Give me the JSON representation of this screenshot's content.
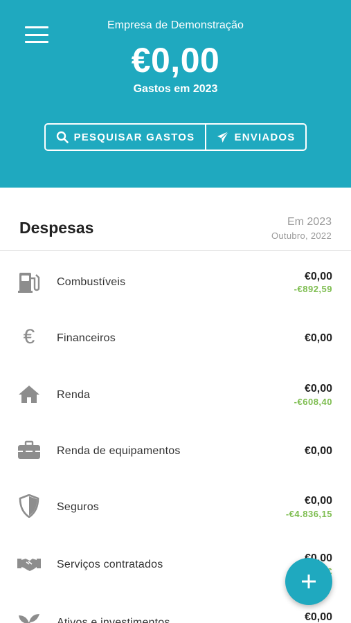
{
  "header": {
    "company": "Empresa de Demonstração",
    "total": "€0,00",
    "total_label": "Gastos em 2023",
    "search_button": "PESQUISAR GASTOS",
    "sent_button": "ENVIADOS"
  },
  "section": {
    "title": "Despesas",
    "period": "Em 2023",
    "compare": "Outubro, 2022"
  },
  "categories": [
    {
      "label": "Combustíveis",
      "icon": "fuel-pump-icon",
      "value": "€0,00",
      "diff": "-€892,59"
    },
    {
      "label": "Financeiros",
      "icon": "euro-icon",
      "value": "€0,00",
      "diff": ""
    },
    {
      "label": "Renda",
      "icon": "home-icon",
      "value": "€0,00",
      "diff": "-€608,40"
    },
    {
      "label": "Renda de equipamentos",
      "icon": "toolbox-icon",
      "value": "€0,00",
      "diff": ""
    },
    {
      "label": "Seguros",
      "icon": "shield-icon",
      "value": "€0,00",
      "diff": "-€4.836,15"
    },
    {
      "label": "Serviços contratados",
      "icon": "handshake-icon",
      "value": "€0,00",
      "diff": "-€"
    },
    {
      "label": "Ativos e investimentos",
      "icon": "plant-icon",
      "value": "€0,00",
      "diff": ""
    }
  ],
  "colors": {
    "header_bg": "#1fa9bf",
    "diff_green": "#7dbd4f",
    "icon_gray": "#8d8d8d"
  }
}
